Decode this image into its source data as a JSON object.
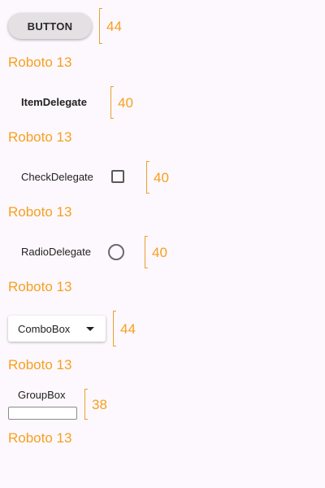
{
  "annotation_color": "#f5a020",
  "font_note": "Roboto 13",
  "rows": [
    {
      "control": "BUTTON",
      "height": "44"
    },
    {
      "control": "ItemDelegate",
      "height": "40"
    },
    {
      "control": "CheckDelegate",
      "height": "40"
    },
    {
      "control": "RadioDelegate",
      "height": "40"
    },
    {
      "control": "ComboBox",
      "height": "44"
    },
    {
      "control": "GroupBox",
      "height": "38"
    }
  ],
  "icons": {
    "checkbox": "checkbox-unchecked-icon",
    "radio": "radio-unchecked-icon",
    "combo": "caret-down-icon"
  }
}
